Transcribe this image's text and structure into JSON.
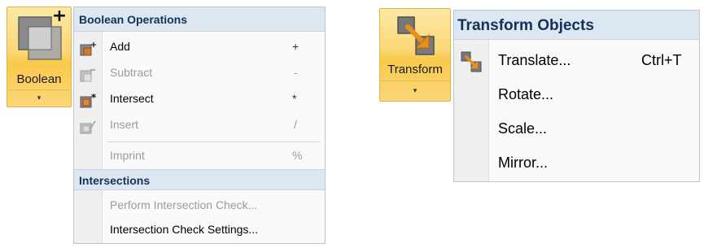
{
  "boolean_button": {
    "label": "Boolean",
    "arrow": "▾"
  },
  "boolean_menu": {
    "header": "Boolean Operations",
    "items": [
      {
        "label": "Add",
        "shortcut": "+"
      },
      {
        "label": "Subtract",
        "shortcut": "-"
      },
      {
        "label": "Intersect",
        "shortcut": "*"
      },
      {
        "label": "Insert",
        "shortcut": "/"
      },
      {
        "label": "Imprint",
        "shortcut": "%"
      }
    ],
    "section2_header": "Intersections",
    "section2_items": [
      {
        "label": "Perform Intersection Check..."
      },
      {
        "label": "Intersection Check Settings..."
      }
    ]
  },
  "transform_button": {
    "label": "Transform",
    "arrow": "▾"
  },
  "transform_menu": {
    "header": "Transform Objects",
    "items": [
      {
        "label": "Translate...",
        "shortcut": "Ctrl+T"
      },
      {
        "label": "Rotate..."
      },
      {
        "label": "Scale..."
      },
      {
        "label": "Mirror..."
      }
    ]
  },
  "icons": {
    "boolean_large": "stacked-squares-plus-icon",
    "add": "add-shape-icon",
    "subtract": "subtract-shape-icon",
    "intersect": "intersect-shape-icon",
    "insert": "insert-shape-icon",
    "transform_large": "transform-arrow-icon",
    "translate": "translate-arrow-icon"
  },
  "colors": {
    "button_gold": "#fbd876",
    "header_bg": "#dde7f2",
    "header_text": "#15315b",
    "disabled_text": "#9a9a9a",
    "arrow_orange": "#e8901e"
  }
}
